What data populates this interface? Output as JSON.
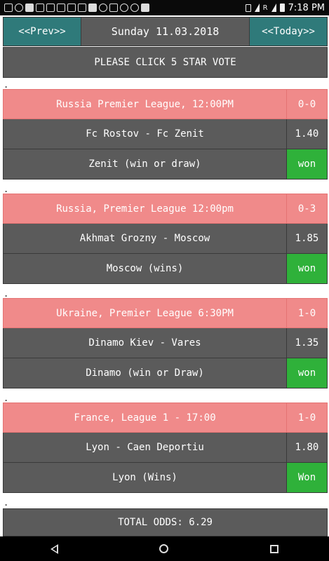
{
  "status_bar": {
    "time": "7:18",
    "am_pm": "PM",
    "signal_label": "R",
    "icons": [
      "notification-icon",
      "bluetooth-icon",
      "app-icon",
      "app-icon",
      "app-icon",
      "app-icon",
      "app-icon",
      "image-icon",
      "app-icon",
      "app-icon",
      "key-icon",
      "bell-icon",
      "whatsapp-icon",
      "app-icon"
    ]
  },
  "header": {
    "prev_label": "<<Prev>>",
    "date": "Sunday 11.03.2018",
    "today_label": "<<Today>>"
  },
  "vote_label": "PLEASE CLICK 5 STAR VOTE",
  "separator": ".",
  "matches": [
    {
      "league": "Russia Premier League, 12:00PM",
      "score": "0-0",
      "teams": "Fc Rostov - Fc Zenit",
      "odds": "1.40",
      "pick": "Zenit (win or draw)",
      "result": "won"
    },
    {
      "league": "Russia, Premier League 12:00pm",
      "score": "0-3",
      "teams": "Akhmat Grozny - Moscow",
      "odds": "1.85",
      "pick": "Moscow (wins)",
      "result": "won"
    },
    {
      "league": "Ukraine, Premier League 6:30PM",
      "score": "1-0",
      "teams": "Dinamo Kiev - Vares",
      "odds": "1.35",
      "pick": "Dinamo (win or Draw)",
      "result": "won"
    },
    {
      "league": "France, League 1 - 17:00",
      "score": "1-0",
      "teams": "Lyon - Caen Deportiu",
      "odds": "1.80",
      "pick": "Lyon (Wins)",
      "result": "Won"
    }
  ],
  "total_label": "TOTAL ODDS: 6.29",
  "colors": {
    "header_button": "#2f7a7a",
    "row_gray": "#5b5b5b",
    "league_pink": "#f08a8a",
    "won_green": "#2fb13a"
  }
}
